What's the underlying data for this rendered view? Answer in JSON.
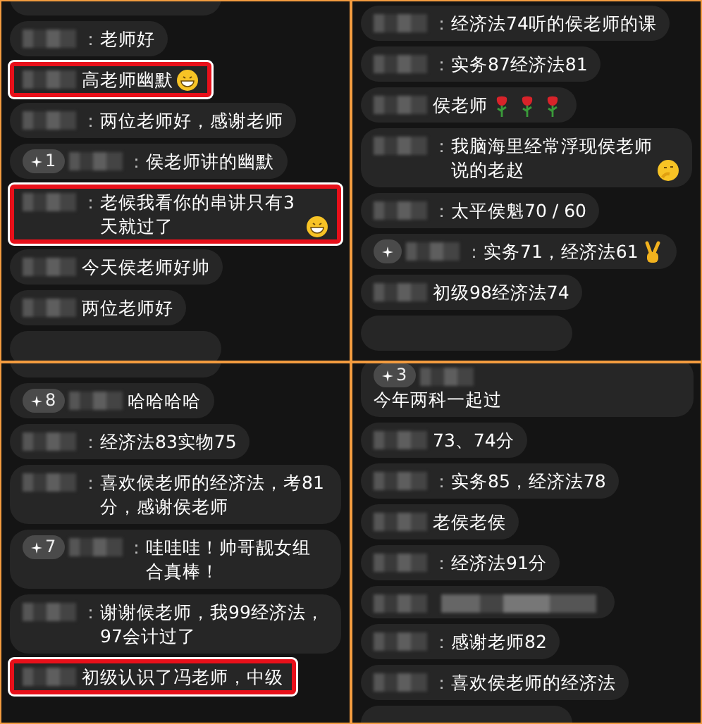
{
  "panels": [
    {
      "messages": [
        {
          "kind": "clipped"
        },
        {
          "kind": "message",
          "sep": "：",
          "text": "老师好"
        },
        {
          "kind": "message",
          "text": "高老师幽默",
          "emoji": [
            {
              "kind": "grin"
            }
          ],
          "highlighted": true
        },
        {
          "kind": "message",
          "sep": "：",
          "text": "两位老师好，感谢老师"
        },
        {
          "kind": "message",
          "badge": {
            "kind": "count",
            "count": "1"
          },
          "sep": "：",
          "text": "侯老师讲的幽默"
        },
        {
          "kind": "message",
          "sep": "：",
          "text": "老候我看你的串讲只有3天就过了",
          "emoji": [
            {
              "kind": "grin"
            }
          ],
          "highlighted": true
        },
        {
          "kind": "message",
          "text": "今天侯老师好帅"
        },
        {
          "kind": "message",
          "text": "两位老师好"
        },
        {
          "kind": "clipped"
        }
      ]
    },
    {
      "messages": [
        {
          "kind": "message",
          "sep": "：",
          "text": "经济法74听的侯老师的课"
        },
        {
          "kind": "message",
          "sep": "：",
          "text": "实务87经济法81"
        },
        {
          "kind": "message",
          "text": "侯老师",
          "emoji": [
            {
              "kind": "rose"
            },
            {
              "kind": "rose"
            },
            {
              "kind": "rose"
            }
          ]
        },
        {
          "kind": "message",
          "sep": "：",
          "text": "我脑海里经常浮现侯老师说的老赵",
          "emoji": [
            {
              "kind": "think"
            }
          ]
        },
        {
          "kind": "message",
          "sep": "：",
          "text": "太平侯魁70 / 60"
        },
        {
          "kind": "message",
          "badge": {
            "kind": "sparkle"
          },
          "sep": "：",
          "text": "实务71，经济法61",
          "emoji": [
            {
              "kind": "victory"
            }
          ]
        },
        {
          "kind": "message",
          "text": "初级98经济法74"
        },
        {
          "kind": "clipped"
        }
      ]
    },
    {
      "messages": [
        {
          "kind": "clipped"
        },
        {
          "kind": "message",
          "badge": {
            "kind": "count",
            "count": "8"
          },
          "text": "哈哈哈哈"
        },
        {
          "kind": "message",
          "sep": "：",
          "text": "经济法83实物75"
        },
        {
          "kind": "message",
          "sep": "：",
          "text": "喜欢候老师的经济法，考81分，感谢侯老师"
        },
        {
          "kind": "message",
          "badge": {
            "kind": "count",
            "count": "7"
          },
          "sep": "：",
          "text": "哇哇哇！帅哥靓女组合真棒！"
        },
        {
          "kind": "message",
          "sep": "：",
          "text": "谢谢候老师，我99经济法，97会计过了"
        },
        {
          "kind": "message",
          "text": "初级认识了冯老师，中级",
          "highlighted": true
        }
      ]
    },
    {
      "messages": [
        {
          "kind": "continued",
          "badge": {
            "kind": "count",
            "count": "3"
          },
          "text": "今年两科一起过"
        },
        {
          "kind": "message",
          "text": "73、74分"
        },
        {
          "kind": "message",
          "sep": "：",
          "text": "实务85，经济法78"
        },
        {
          "kind": "message",
          "text": "老侯老侯"
        },
        {
          "kind": "message",
          "sep": "：",
          "text": "经济法91分"
        },
        {
          "kind": "blurred"
        },
        {
          "kind": "message",
          "sep": "：",
          "text": "感谢老师82"
        },
        {
          "kind": "message",
          "sep": "：",
          "text": "喜欢侯老师的经济法"
        },
        {
          "kind": "clipped"
        }
      ]
    }
  ]
}
